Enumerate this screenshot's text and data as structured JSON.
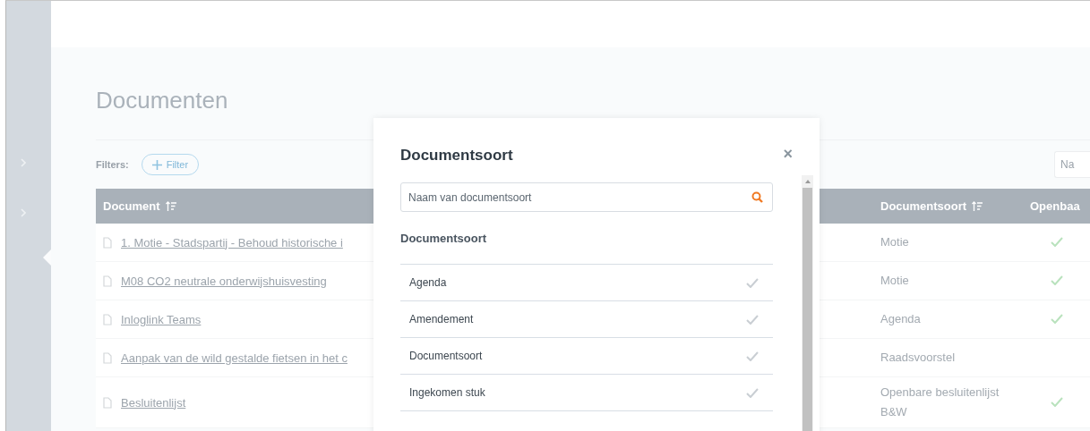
{
  "page": {
    "title": "Documenten",
    "filters_label": "Filters:",
    "filter_button": "Filter",
    "search_placeholder": "Na"
  },
  "table": {
    "columns": [
      {
        "label": "Document",
        "sortable": true
      },
      {
        "label": "Documentsoort",
        "sortable": true
      },
      {
        "label": "Openbaa",
        "sortable": false
      }
    ],
    "rows": [
      {
        "document": "1. Motie - Stadspartij - Behoud historische i",
        "documentsoort": "Motie",
        "openbaar": true
      },
      {
        "document": "M08 CO2 neutrale onderwijshuisvesting",
        "documentsoort": "Motie",
        "openbaar": true
      },
      {
        "document": "Inloglink Teams",
        "documentsoort": "Agenda",
        "openbaar": true
      },
      {
        "document": "Aanpak van de wild gestalde fietsen in het c",
        "documentsoort": "Raadsvoorstel",
        "openbaar": false
      },
      {
        "document": "Besluitenlijst",
        "documentsoort": "Openbare besluitenlijst B&W",
        "openbaar": true
      }
    ]
  },
  "modal": {
    "title": "Documentsoort",
    "close": "×",
    "search_placeholder": "Naam van documentsoort",
    "section_title": "Documentsoort",
    "options": [
      {
        "label": "Agenda",
        "selected": false
      },
      {
        "label": "Amendement",
        "selected": false
      },
      {
        "label": "Documentsoort",
        "selected": false
      },
      {
        "label": "Ingekomen stuk",
        "selected": false
      }
    ]
  }
}
